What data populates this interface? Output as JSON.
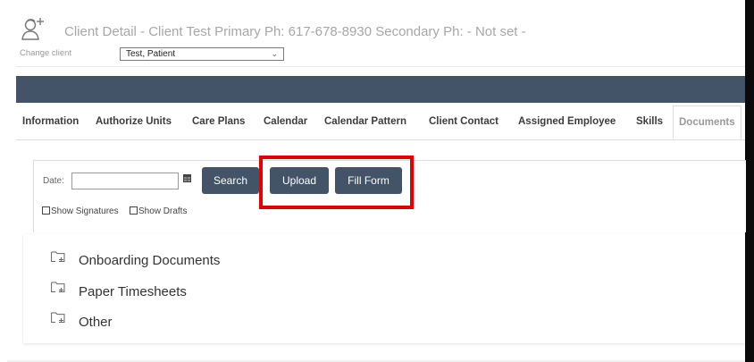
{
  "header": {
    "title": "Client Detail - Client Test Primary Ph: 617-678-8930 Secondary Ph: - Not set -",
    "change_client_label": "Change client",
    "selected_client": "Test, Patient"
  },
  "tabs": [
    {
      "label": "Information"
    },
    {
      "label": "Authorize Units"
    },
    {
      "label": "Care Plans"
    },
    {
      "label": "Calendar"
    },
    {
      "label": "Calendar Pattern"
    },
    {
      "label": "Client Contact"
    },
    {
      "label": "Assigned Employee"
    },
    {
      "label": "Skills"
    },
    {
      "label": "Documents",
      "active": true
    }
  ],
  "filters": {
    "date_label": "Date:",
    "date_value": "",
    "search_label": "Search",
    "upload_label": "Upload",
    "fill_form_label": "Fill Form",
    "show_signatures_label": "Show Signatures",
    "show_drafts_label": "Show Drafts"
  },
  "folders": [
    {
      "label": "Onboarding Documents"
    },
    {
      "label": "Paper Timesheets"
    },
    {
      "label": "Other"
    }
  ],
  "colors": {
    "nav": "#435468",
    "button": "#435468",
    "highlight": "#e30000"
  }
}
